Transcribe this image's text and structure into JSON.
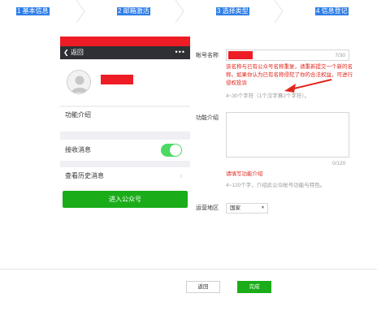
{
  "steps": [
    {
      "label": "1 基本信息"
    },
    {
      "label": "2 邮箱激活"
    },
    {
      "label": "3 选择类型"
    },
    {
      "label": "4 信息登记"
    }
  ],
  "phone": {
    "back_label": "返回",
    "more_icon": "more-dots-icon",
    "func_intro_label": "功能介绍",
    "receive_msgs_label": "接收消息",
    "receive_msgs_on": true,
    "history_label": "查看历史消息",
    "enter_button": "进入公众号",
    "status_bar_color": "#ee1c25",
    "nav_color": "#2f3034",
    "toggle_color": "#4cd964",
    "button_color": "#1aad19"
  },
  "form": {
    "account_name": {
      "label": "帐号名称",
      "value": "",
      "counter": "7/30",
      "warning": "该名称与已有公众号名称重复，请重新提交一个新的名称。如果你认为已有名称侵犯了你的合法权益，可进行侵权投诉",
      "hint": "4~30个字符（1个汉字算2个字符）。"
    },
    "func_intro": {
      "label": "功能介绍",
      "value": "",
      "counter": "0/120",
      "error": "请填写功能介绍",
      "hint": "4~120个字，介绍此公众帐号功能与特色。"
    },
    "region": {
      "label": "运营地区",
      "value": "国家"
    },
    "back_button": "返回",
    "done_button": "完成"
  },
  "colors": {
    "step_highlight": "#2f7fe8",
    "warning_text": "#e1251b",
    "primary_green": "#1aad19",
    "redaction": "#ee1c25"
  }
}
